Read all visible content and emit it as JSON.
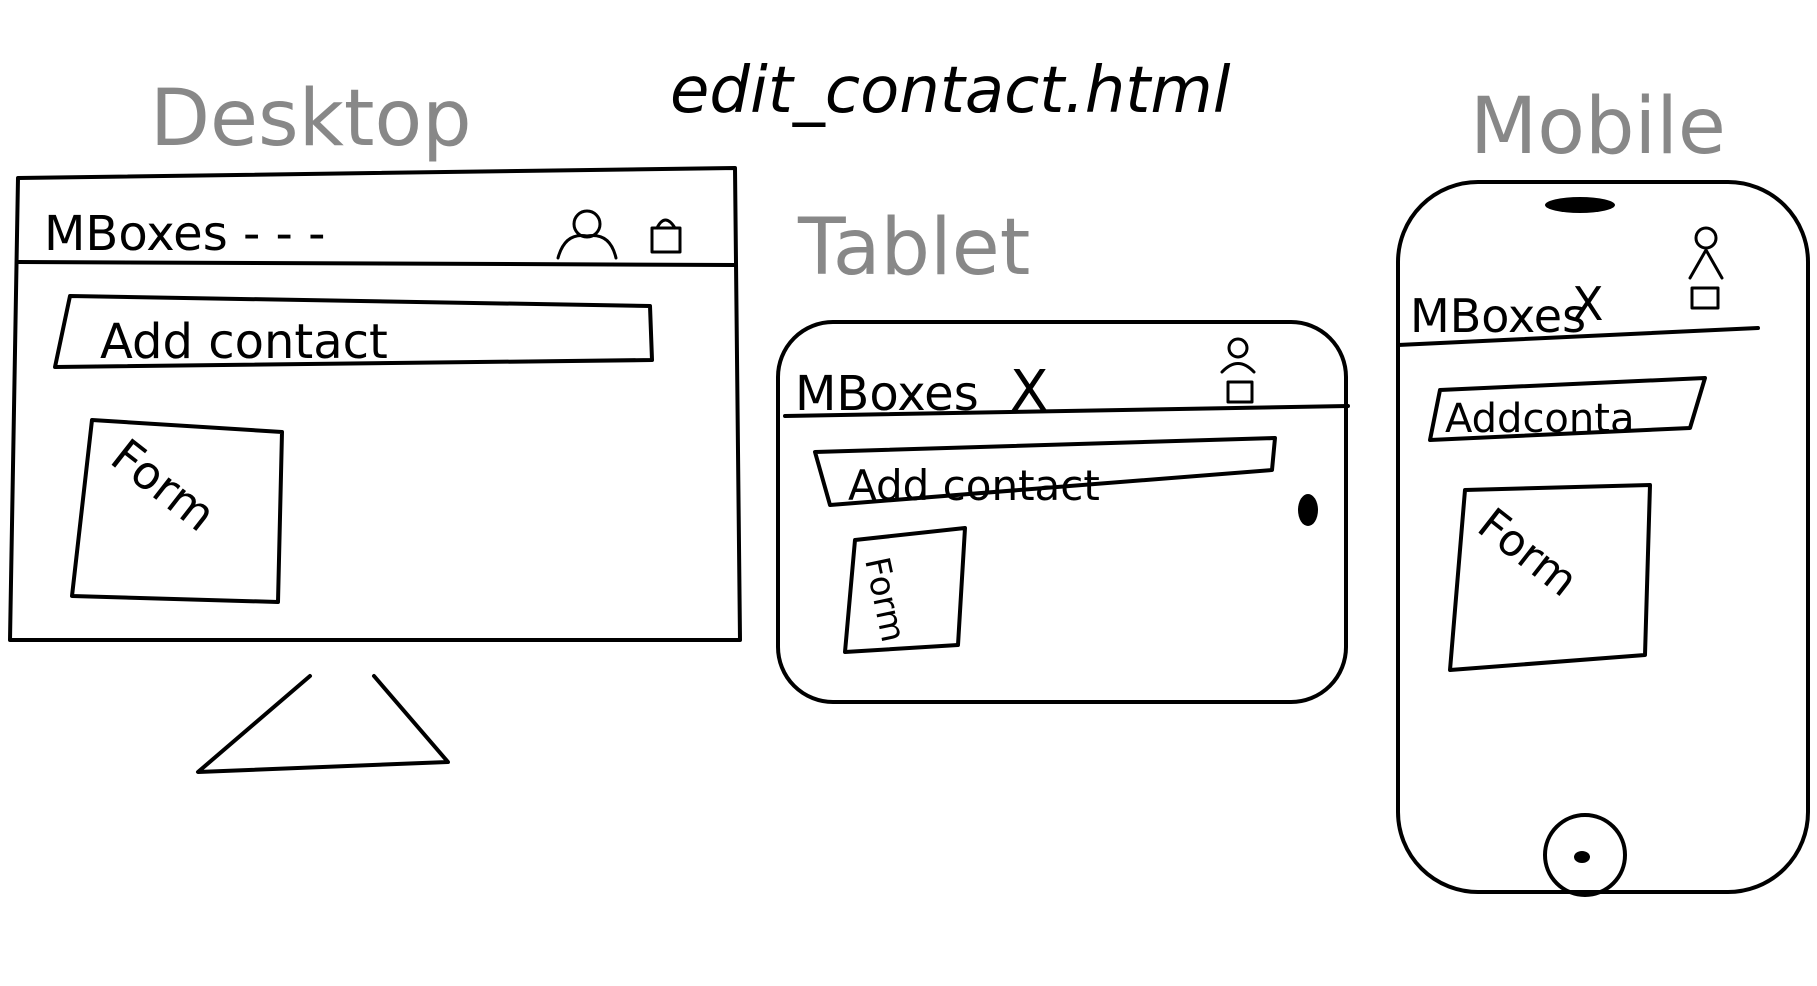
{
  "title": "edit_contact.html",
  "ink_color": "#000000",
  "label_color": "#888888",
  "desktop": {
    "label": "Desktop",
    "brand": "MBoxes - - -",
    "header_text": "Add contact",
    "form_label": "Form",
    "icons": [
      "user-icon",
      "lock-icon"
    ]
  },
  "tablet": {
    "label": "Tablet",
    "brand": "MBoxes",
    "close_mark": "X",
    "header_text": "Add contact",
    "form_label": "Form",
    "icons": [
      "user-icon",
      "lock-icon",
      "home-button-icon"
    ]
  },
  "mobile": {
    "label": "Mobile",
    "brand": "MBoxes",
    "close_mark": "X",
    "header_text": "Addconta",
    "form_label": "Form",
    "icons": [
      "user-icon",
      "lock-icon",
      "speaker-icon",
      "home-button-icon"
    ]
  }
}
